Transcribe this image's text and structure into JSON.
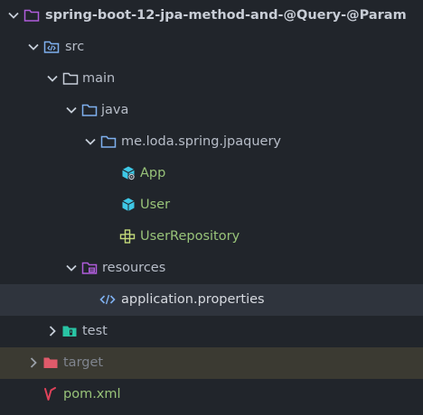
{
  "explorer": {
    "root": {
      "label": "spring-boot-12-jpa-method-and-@Query-@Param",
      "icon": "folder-icon",
      "expanded": true
    },
    "src": {
      "label": "src",
      "icon": "source-folder-icon",
      "expanded": true
    },
    "main": {
      "label": "main",
      "icon": "folder-icon",
      "expanded": true
    },
    "java": {
      "label": "java",
      "icon": "folder-icon",
      "expanded": true
    },
    "package": {
      "label": "me.loda.spring.jpaquery",
      "icon": "package-folder-icon",
      "expanded": true
    },
    "app": {
      "label": "App",
      "icon": "java-class-main-icon"
    },
    "user": {
      "label": "User",
      "icon": "java-class-icon"
    },
    "repository": {
      "label": "UserRepository",
      "icon": "java-interface-icon"
    },
    "resources": {
      "label": "resources",
      "icon": "resources-folder-icon",
      "expanded": true
    },
    "properties": {
      "label": "application.properties",
      "icon": "code-file-icon",
      "selected": true
    },
    "test": {
      "label": "test",
      "icon": "test-folder-icon",
      "expanded": false
    },
    "target": {
      "label": "target",
      "icon": "target-folder-icon",
      "expanded": false
    },
    "pom": {
      "label": "pom.xml",
      "icon": "maven-icon"
    }
  },
  "colors": {
    "background": "#21252b",
    "selected_row": "#2f343d",
    "ignored_row": "#3b3a32",
    "folder_outline": "#c7ced9",
    "folder_blue": "#7fb0ef",
    "folder_purple": "#b05ddb",
    "folder_green": "#29c4a4",
    "folder_red": "#e05a6a",
    "class_cyan": "#3ec8e6",
    "text_green": "#98c379",
    "maven_red": "#e0425a"
  }
}
